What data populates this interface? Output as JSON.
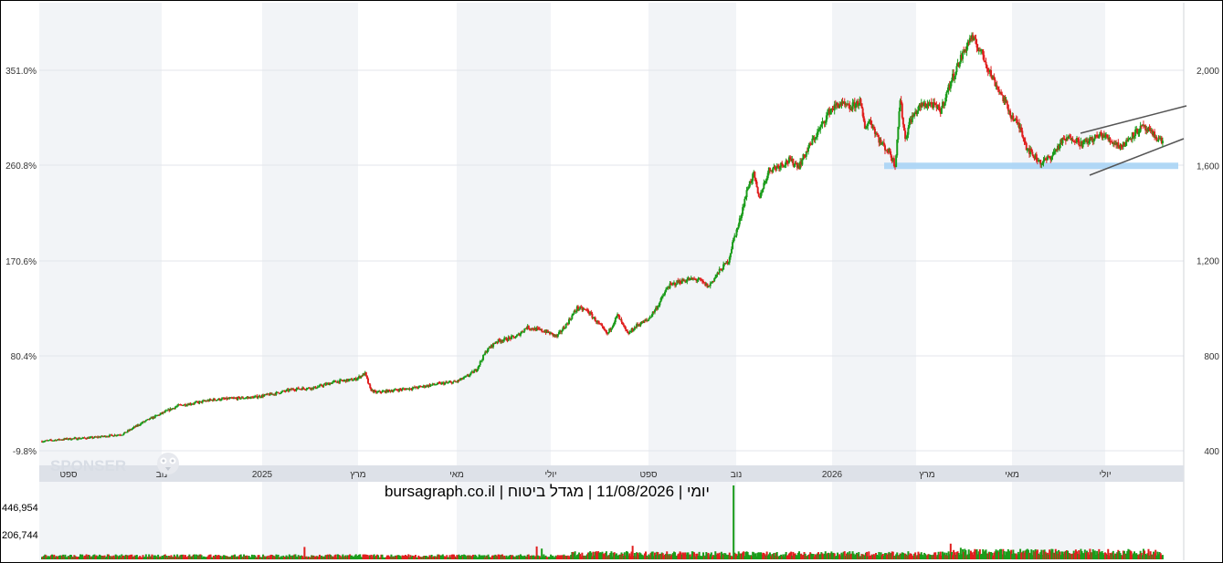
{
  "chart_data": {
    "type": "candlestick",
    "caption": "יומי | 11/08/2026 | מגדל ביטוח | bursagraph.co.il",
    "watermark": "SPONSER",
    "colors": {
      "up": "#1a9c1a",
      "down": "#e01e1e",
      "support_band": "#a9d4f5",
      "channel": "#555555",
      "band_shading": "#f2f4f7",
      "time_strip": "#dde1e8"
    },
    "left_axis": {
      "ticks": [
        "351.0%",
        "260.8%",
        "170.6%",
        "80.4%",
        "-9.8%"
      ],
      "values": [
        351.0,
        260.8,
        170.6,
        80.4,
        -9.8
      ]
    },
    "right_axis": {
      "ticks": [
        "2,000",
        "1,600",
        "1,200",
        "800",
        "400"
      ],
      "values": [
        2000,
        1600,
        1200,
        800,
        400
      ],
      "ylim": [
        400,
        2000
      ]
    },
    "month_labels": [
      "ספט",
      "נוב",
      "2025",
      "מרץ",
      "מאי",
      "יולי",
      "ספט",
      "נוב",
      "2026",
      "מרץ",
      "מאי",
      "יולי"
    ],
    "volume_axis": {
      "ticks": [
        "446,954",
        "206,744"
      ],
      "values": [
        446954,
        206744
      ]
    },
    "price_path": [
      [
        0,
        440
      ],
      [
        5,
        450
      ],
      [
        10,
        455
      ],
      [
        16,
        470
      ],
      [
        20,
        520
      ],
      [
        24,
        560
      ],
      [
        27,
        590
      ],
      [
        30,
        600
      ],
      [
        34,
        615
      ],
      [
        38,
        620
      ],
      [
        42,
        625
      ],
      [
        46,
        640
      ],
      [
        50,
        660
      ],
      [
        54,
        665
      ],
      [
        58,
        690
      ],
      [
        62,
        700
      ],
      [
        64,
        725
      ],
      [
        65,
        660
      ],
      [
        66,
        645
      ],
      [
        70,
        655
      ],
      [
        74,
        665
      ],
      [
        78,
        680
      ],
      [
        82,
        690
      ],
      [
        84,
        710
      ],
      [
        86,
        740
      ],
      [
        88,
        820
      ],
      [
        90,
        860
      ],
      [
        94,
        880
      ],
      [
        96,
        920
      ],
      [
        100,
        900
      ],
      [
        102,
        880
      ],
      [
        104,
        935
      ],
      [
        106,
        1000
      ],
      [
        108,
        990
      ],
      [
        110,
        940
      ],
      [
        112,
        890
      ],
      [
        114,
        970
      ],
      [
        116,
        890
      ],
      [
        118,
        930
      ],
      [
        120,
        950
      ],
      [
        122,
        1010
      ],
      [
        124,
        1090
      ],
      [
        126,
        1110
      ],
      [
        128,
        1120
      ],
      [
        130,
        1120
      ],
      [
        132,
        1090
      ],
      [
        134,
        1150
      ],
      [
        136,
        1200
      ],
      [
        137,
        1290
      ],
      [
        138,
        1350
      ],
      [
        139,
        1440
      ],
      [
        140,
        1520
      ],
      [
        141,
        1560
      ],
      [
        142,
        1460
      ],
      [
        144,
        1580
      ],
      [
        146,
        1600
      ],
      [
        148,
        1620
      ],
      [
        150,
        1600
      ],
      [
        152,
        1680
      ],
      [
        154,
        1750
      ],
      [
        156,
        1830
      ],
      [
        158,
        1860
      ],
      [
        160,
        1840
      ],
      [
        162,
        1870
      ],
      [
        163,
        1760
      ],
      [
        164,
        1790
      ],
      [
        166,
        1700
      ],
      [
        168,
        1650
      ],
      [
        169,
        1600
      ],
      [
        170,
        1880
      ],
      [
        171,
        1710
      ],
      [
        172,
        1790
      ],
      [
        174,
        1850
      ],
      [
        176,
        1860
      ],
      [
        178,
        1830
      ],
      [
        180,
        1950
      ],
      [
        182,
        2050
      ],
      [
        184,
        2140
      ],
      [
        186,
        2080
      ],
      [
        188,
        1980
      ],
      [
        190,
        1900
      ],
      [
        192,
        1810
      ],
      [
        194,
        1750
      ],
      [
        195,
        1680
      ],
      [
        196,
        1650
      ],
      [
        198,
        1610
      ],
      [
        200,
        1640
      ],
      [
        202,
        1700
      ],
      [
        204,
        1720
      ],
      [
        206,
        1690
      ],
      [
        208,
        1710
      ],
      [
        210,
        1730
      ],
      [
        212,
        1700
      ],
      [
        214,
        1680
      ],
      [
        216,
        1730
      ],
      [
        218,
        1760
      ],
      [
        220,
        1730
      ],
      [
        222,
        1700
      ]
    ],
    "volume_profile": {
      "baseline_level": 22000,
      "spikes": [
        {
          "day": 52,
          "value": 75000
        },
        {
          "day": 98,
          "value": 78000
        },
        {
          "day": 99,
          "value": 65000
        },
        {
          "day": 117,
          "value": 82000
        },
        {
          "day": 137,
          "value": 446954
        },
        {
          "day": 180,
          "value": 95000
        },
        {
          "day": 182,
          "value": 70000
        },
        {
          "day": 196,
          "value": 60000
        }
      ]
    }
  }
}
